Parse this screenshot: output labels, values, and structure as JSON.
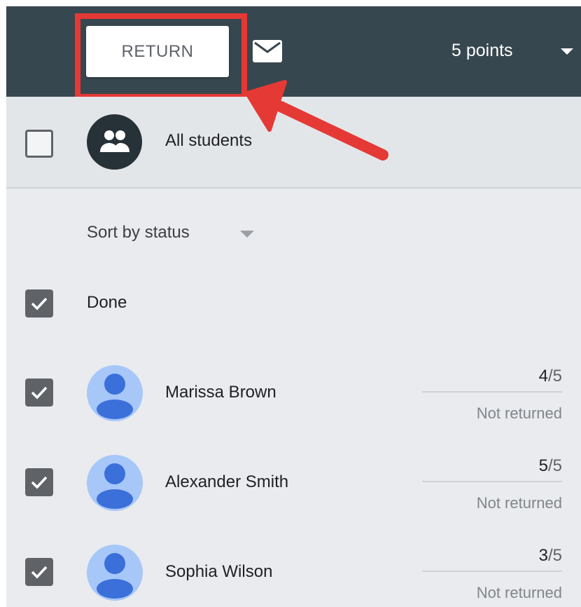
{
  "toolbar": {
    "return_label": "RETURN",
    "points_label": "5 points"
  },
  "all_students": {
    "label": "All students"
  },
  "sort": {
    "label": "Sort by status"
  },
  "group": {
    "label": "Done"
  },
  "students": [
    {
      "name": "Marissa Brown",
      "score": "4",
      "max": "/5",
      "status": "Not returned"
    },
    {
      "name": "Alexander Smith",
      "score": "5",
      "max": "/5",
      "status": "Not returned"
    },
    {
      "name": "Sophia Wilson",
      "score": "3",
      "max": "/5",
      "status": "Not returned"
    }
  ],
  "colors": {
    "toolbar_bg": "#37474f",
    "highlight": "#e53935",
    "avatar_bg": "#a7c7f9",
    "avatar_fg": "#3b6fd9"
  },
  "icons": [
    "mail-icon",
    "dropdown-caret-icon",
    "group-icon",
    "checkbox-check-icon",
    "person-avatar-icon",
    "annotation-arrow"
  ]
}
